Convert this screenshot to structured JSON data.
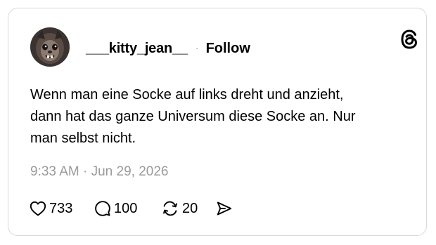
{
  "post": {
    "username": "___kitty_jean__",
    "separator": "·",
    "follow_label": "Follow",
    "text": "Wenn man eine Socke auf links dreht und anzieht,\ndann hat das ganze Universum diese Socke an. Nur\nman selbst nicht.",
    "timestamp": "9:33 AM · Jun 29, 2026"
  },
  "actions": {
    "like_count": "733",
    "reply_count": "100",
    "repost_count": "20"
  },
  "icons": {
    "brand": "threads-logo-icon",
    "like": "heart-icon",
    "reply": "comment-icon",
    "repost": "repost-icon",
    "share": "send-icon"
  },
  "colors": {
    "text": "#000000",
    "muted": "#9a9a9a",
    "border": "#d9d9d9"
  }
}
